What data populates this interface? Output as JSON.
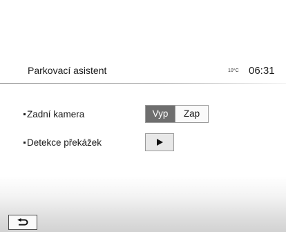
{
  "header": {
    "title": "Parkovací asistent",
    "temperature": "10°C",
    "clock": "06:31"
  },
  "settings": {
    "rear_camera": {
      "label": "Zadní kamera",
      "options": [
        "Vyp",
        "Zap"
      ],
      "selected": "Vyp"
    },
    "obstacle_detection": {
      "label": "Detekce překážek",
      "button_icon": "play-icon"
    }
  },
  "footer": {
    "back_icon": "back-arrow-icon"
  },
  "colors": {
    "selected_segment": "#6e6e6e",
    "background": "#ffffff"
  }
}
